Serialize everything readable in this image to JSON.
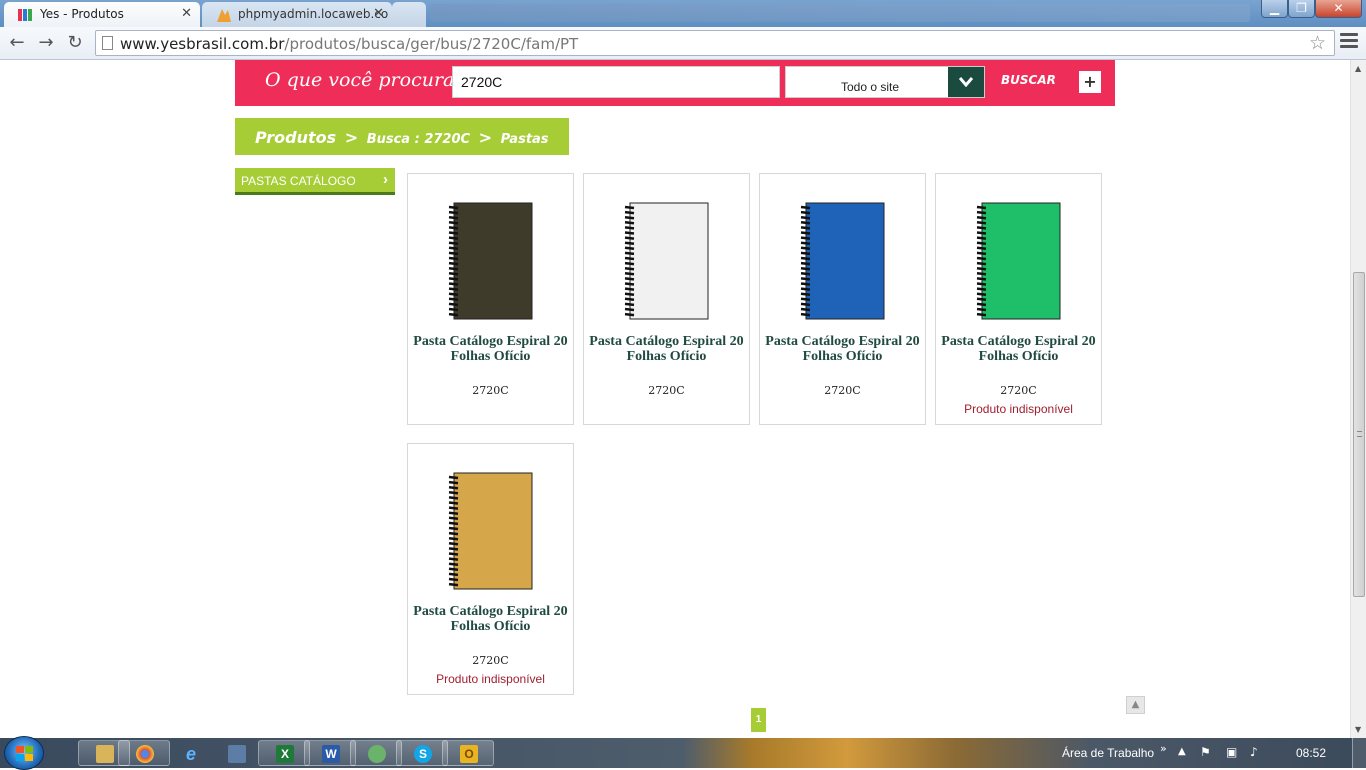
{
  "browser": {
    "tabs": [
      {
        "title": "Yes - Produtos",
        "active": true
      },
      {
        "title": "phpmyadmin.locaweb.co",
        "active": false
      }
    ],
    "url_host": "www.yesbrasil.com.br",
    "url_path": "/produtos/busca/ger/bus/2720C/fam/PT"
  },
  "search": {
    "label": "O que você procura ?",
    "value": "2720C",
    "scope": "Todo o site",
    "button": "BUSCAR",
    "plus": "+"
  },
  "breadcrumb": {
    "root": "Produtos",
    "sep": ">",
    "search": "Busca : 2720C",
    "category": "Pastas"
  },
  "sidebar": {
    "items": [
      {
        "label": "PASTAS CATÁLOGO"
      }
    ]
  },
  "products": [
    {
      "name": "Pasta Catálogo Espiral 20 Folhas Ofício",
      "code": "2720C",
      "status": "",
      "color": "#3f3b2a"
    },
    {
      "name": "Pasta Catálogo Espiral 20 Folhas Ofício",
      "code": "2720C",
      "status": "",
      "color": "#f1f1f1"
    },
    {
      "name": "Pasta Catálogo Espiral 20 Folhas Ofício",
      "code": "2720C",
      "status": "",
      "color": "#1e63b8"
    },
    {
      "name": "Pasta Catálogo Espiral 20 Folhas Ofício",
      "code": "2720C",
      "status": "Produto indisponível",
      "color": "#1fbf6a"
    },
    {
      "name": "Pasta Catálogo Espiral 20 Folhas Ofício",
      "code": "2720C",
      "status": "Produto indisponível",
      "color": "#d6a64a"
    }
  ],
  "pagination": {
    "current": "1"
  },
  "taskbar": {
    "desktop_label": "Área de Trabalho",
    "time": "08:52",
    "apps": [
      "explorer",
      "chrome",
      "ie",
      "network",
      "excel",
      "word",
      "messenger",
      "skype",
      "outlook"
    ]
  }
}
